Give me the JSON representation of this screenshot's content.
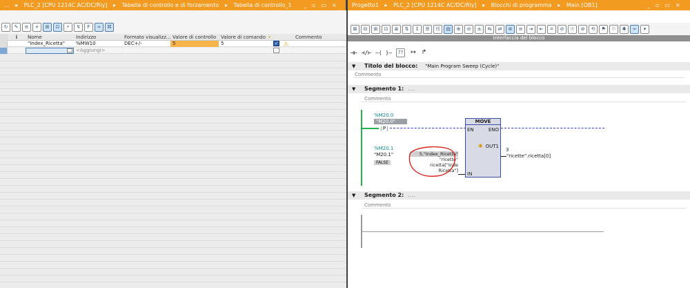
{
  "left_title": {
    "crumbs": [
      "...",
      "PLC_2 [CPU 1214C AC/DC/Rly]",
      "Tabella di controllo e di forzamento",
      "Tabella di controllo_1"
    ],
    "controls": [
      "_",
      "▫",
      "▭",
      "×"
    ]
  },
  "right_title": {
    "crumbs": [
      "Progetto1",
      "PLC_2 [CPU 1214C AC/DC/Rly]",
      "Blocchi di programma",
      "Main [OB1]"
    ],
    "controls": [
      "_",
      "▫",
      "▭",
      "×"
    ]
  },
  "watch_table": {
    "columns": [
      "i",
      "Nome",
      "Indirizzo",
      "Formato visualizz...",
      "Valore di controllo",
      "Valore di comando",
      "⚡",
      "Commento"
    ],
    "rows": [
      {
        "nome": "\"Index_Ricetta\"",
        "indirizzo": "%MW10",
        "formato": "DEC+/-",
        "controllo": "5",
        "comando": "5",
        "checked": true,
        "warning": true
      },
      {
        "nome": "",
        "indirizzo": "<Aggiungi>",
        "formato": "",
        "controllo": "",
        "comando": "",
        "checked": false,
        "warning": false
      }
    ],
    "colors": {
      "controllo_highlight": "#f7b44a",
      "selected_cell": "#dbe8f6"
    }
  },
  "block_editor": {
    "interface_label": "Interfaccia del blocco",
    "block_title_label": "Titolo del blocco:",
    "block_title_value": "\"Main Program Sweep (Cycle)\"",
    "comment_label": "Commento",
    "segments": [
      {
        "label": "Segmento 1:",
        "dots": "....",
        "comment": "Commento"
      },
      {
        "label": "Segmento 2:",
        "dots": "....",
        "comment": "Commento"
      }
    ],
    "lad": {
      "contact1_addr": "%M20.0",
      "contact1_name": "\"M20.0\"",
      "contact1_symbol": "P",
      "contact2_addr": "%M20.1",
      "contact2_name": "\"M20.1\"",
      "contact2_state": "FALSE",
      "move_title": "MOVE",
      "en": "EN",
      "eno": "ENO",
      "out1": "OUT1",
      "in": "IN",
      "in_value_line1": "5,\"Index_Ricetta\"",
      "in_value_line2": "\"ricette\"",
      "in_value_line3": "ricetta[\"Inde",
      "in_value_line4": "Ricetta\"]",
      "out_value": "3",
      "out_operand": "\"ricette\".ricetta[0]"
    },
    "colors": {
      "rail_green": "#22b24c",
      "box_fill": "#d8dbe6",
      "box_border": "#3a4ea8",
      "wire_blue": "#2a3fd0",
      "circle_red": "#d9261c"
    }
  }
}
